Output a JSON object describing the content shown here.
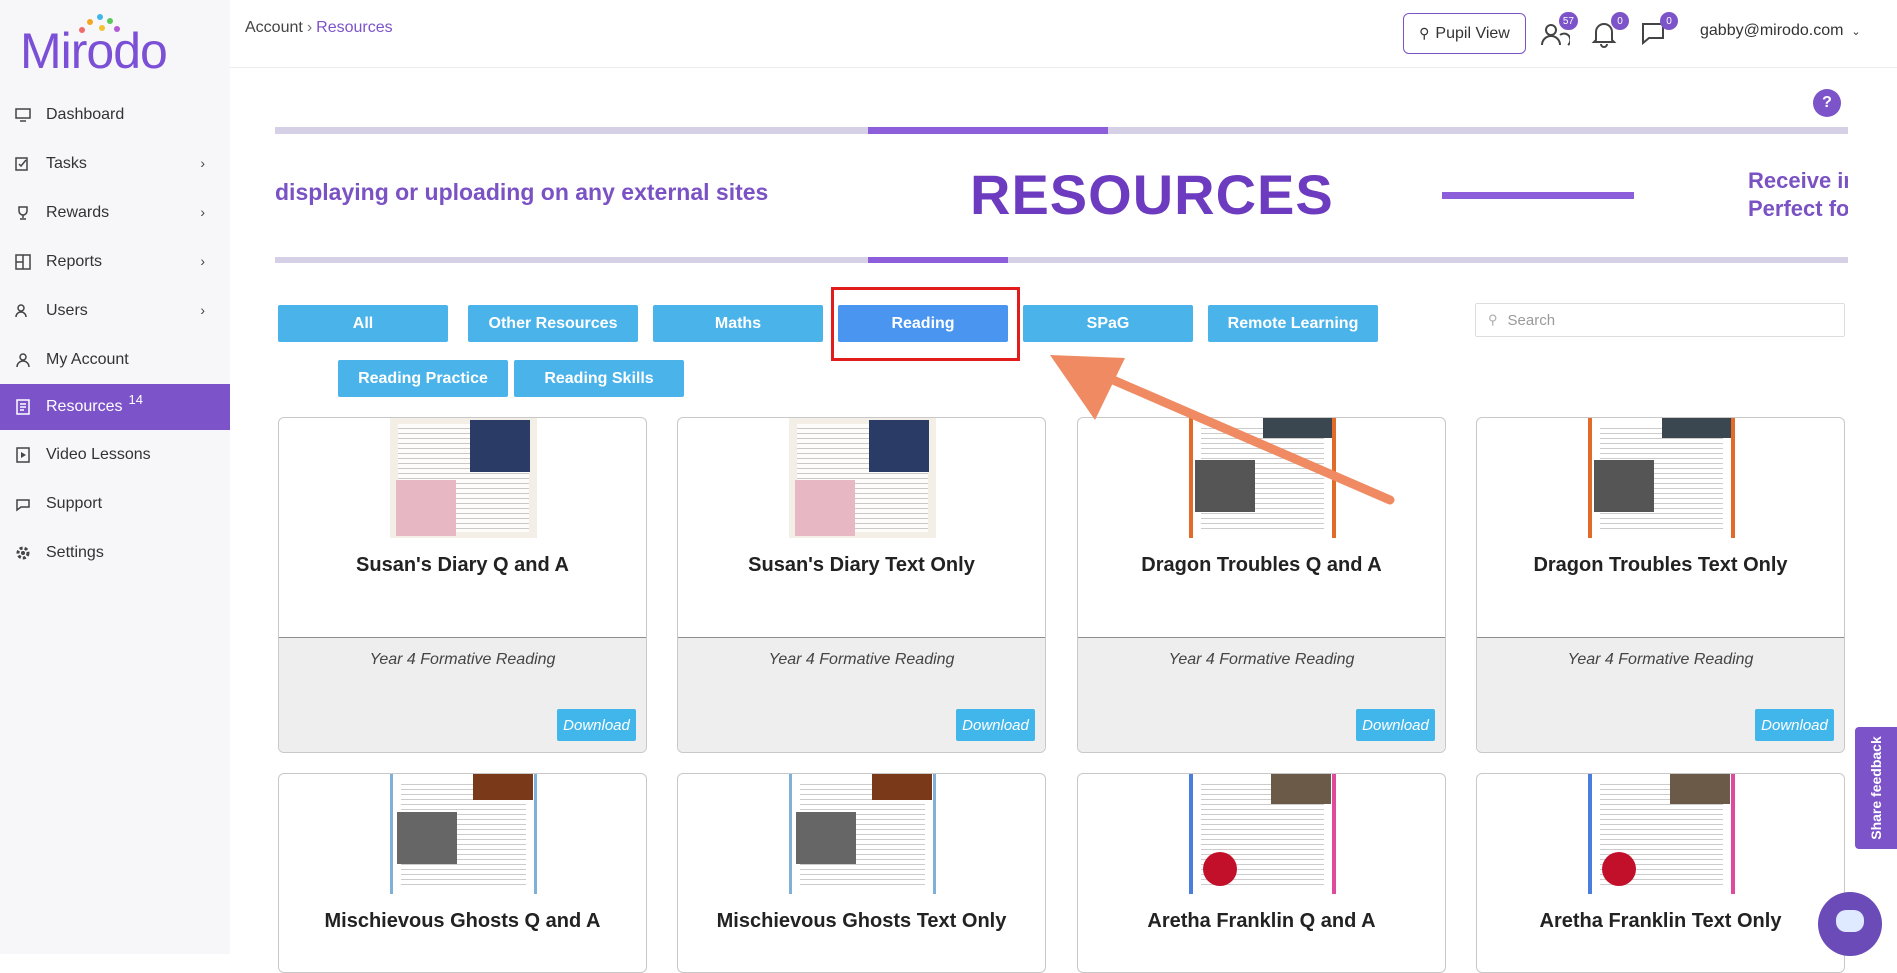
{
  "app": {
    "logo_text": "Mirodo"
  },
  "sidebar": {
    "items": [
      {
        "label": "Dashboard",
        "icon": "monitor-icon",
        "has_submenu": false
      },
      {
        "label": "Tasks",
        "icon": "tasks-icon",
        "has_submenu": true
      },
      {
        "label": "Rewards",
        "icon": "trophy-icon",
        "has_submenu": true
      },
      {
        "label": "Reports",
        "icon": "reports-icon",
        "has_submenu": true
      },
      {
        "label": "Users",
        "icon": "users-icon",
        "has_submenu": true
      },
      {
        "label": "My Account",
        "icon": "account-icon",
        "has_submenu": false
      },
      {
        "label": "Resources",
        "icon": "resources-icon",
        "has_submenu": false,
        "active": true,
        "count": "14"
      },
      {
        "label": "Video Lessons",
        "icon": "video-icon",
        "has_submenu": false
      },
      {
        "label": "Support",
        "icon": "support-icon",
        "has_submenu": false
      },
      {
        "label": "Settings",
        "icon": "gear-icon",
        "has_submenu": false
      }
    ]
  },
  "header": {
    "breadcrumb": {
      "parent": "Account",
      "separator": "›",
      "current": "Resources"
    },
    "pupil_view_label": "Pupil View",
    "users_count": "57",
    "notifications_count": "0",
    "messages_count": "0",
    "user_email": "gabby@mirodo.com"
  },
  "help_label": "?",
  "banner": {
    "left_text": "displaying or uploading on any external sites",
    "title": "RESOURCES",
    "right_text_line1": "Receive ir",
    "right_text_line2": "Perfect fo"
  },
  "filters": {
    "row1": [
      "All",
      "Other Resources",
      "Maths",
      "Reading",
      "SPaG",
      "Remote Learning"
    ],
    "row2": [
      "Reading Practice",
      "Reading Skills"
    ],
    "active": "Reading"
  },
  "search": {
    "placeholder": "Search"
  },
  "cards": [
    {
      "title": "Susan's Diary Q and A",
      "subtitle": "Year 4 Formative Reading",
      "download": "Download"
    },
    {
      "title": "Susan's Diary Text Only",
      "subtitle": "Year 4 Formative Reading",
      "download": "Download"
    },
    {
      "title": "Dragon Troubles Q and A",
      "subtitle": "Year 4 Formative Reading",
      "download": "Download"
    },
    {
      "title": "Dragon Troubles Text Only",
      "subtitle": "Year 4 Formative Reading",
      "download": "Download"
    },
    {
      "title": "Mischievous Ghosts Q and A"
    },
    {
      "title": "Mischievous Ghosts Text Only"
    },
    {
      "title": "Aretha Franklin Q and A"
    },
    {
      "title": "Aretha Franklin Text Only"
    }
  ],
  "feedback_label": "Share feedback",
  "colors": {
    "brand": "#7d53c9",
    "filter": "#4ab3ea",
    "highlight": "#e21b1b",
    "arrow": "#ef8a62"
  }
}
